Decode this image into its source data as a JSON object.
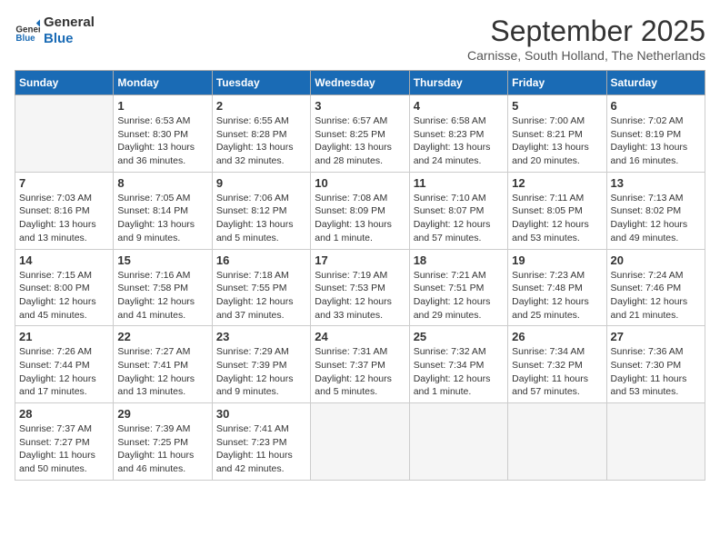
{
  "logo": {
    "text1": "General",
    "text2": "Blue"
  },
  "title": "September 2025",
  "location": "Carnisse, South Holland, The Netherlands",
  "weekdays": [
    "Sunday",
    "Monday",
    "Tuesday",
    "Wednesday",
    "Thursday",
    "Friday",
    "Saturday"
  ],
  "weeks": [
    [
      {
        "day": "",
        "info": ""
      },
      {
        "day": "1",
        "info": "Sunrise: 6:53 AM\nSunset: 8:30 PM\nDaylight: 13 hours\nand 36 minutes."
      },
      {
        "day": "2",
        "info": "Sunrise: 6:55 AM\nSunset: 8:28 PM\nDaylight: 13 hours\nand 32 minutes."
      },
      {
        "day": "3",
        "info": "Sunrise: 6:57 AM\nSunset: 8:25 PM\nDaylight: 13 hours\nand 28 minutes."
      },
      {
        "day": "4",
        "info": "Sunrise: 6:58 AM\nSunset: 8:23 PM\nDaylight: 13 hours\nand 24 minutes."
      },
      {
        "day": "5",
        "info": "Sunrise: 7:00 AM\nSunset: 8:21 PM\nDaylight: 13 hours\nand 20 minutes."
      },
      {
        "day": "6",
        "info": "Sunrise: 7:02 AM\nSunset: 8:19 PM\nDaylight: 13 hours\nand 16 minutes."
      }
    ],
    [
      {
        "day": "7",
        "info": "Sunrise: 7:03 AM\nSunset: 8:16 PM\nDaylight: 13 hours\nand 13 minutes."
      },
      {
        "day": "8",
        "info": "Sunrise: 7:05 AM\nSunset: 8:14 PM\nDaylight: 13 hours\nand 9 minutes."
      },
      {
        "day": "9",
        "info": "Sunrise: 7:06 AM\nSunset: 8:12 PM\nDaylight: 13 hours\nand 5 minutes."
      },
      {
        "day": "10",
        "info": "Sunrise: 7:08 AM\nSunset: 8:09 PM\nDaylight: 13 hours\nand 1 minute."
      },
      {
        "day": "11",
        "info": "Sunrise: 7:10 AM\nSunset: 8:07 PM\nDaylight: 12 hours\nand 57 minutes."
      },
      {
        "day": "12",
        "info": "Sunrise: 7:11 AM\nSunset: 8:05 PM\nDaylight: 12 hours\nand 53 minutes."
      },
      {
        "day": "13",
        "info": "Sunrise: 7:13 AM\nSunset: 8:02 PM\nDaylight: 12 hours\nand 49 minutes."
      }
    ],
    [
      {
        "day": "14",
        "info": "Sunrise: 7:15 AM\nSunset: 8:00 PM\nDaylight: 12 hours\nand 45 minutes."
      },
      {
        "day": "15",
        "info": "Sunrise: 7:16 AM\nSunset: 7:58 PM\nDaylight: 12 hours\nand 41 minutes."
      },
      {
        "day": "16",
        "info": "Sunrise: 7:18 AM\nSunset: 7:55 PM\nDaylight: 12 hours\nand 37 minutes."
      },
      {
        "day": "17",
        "info": "Sunrise: 7:19 AM\nSunset: 7:53 PM\nDaylight: 12 hours\nand 33 minutes."
      },
      {
        "day": "18",
        "info": "Sunrise: 7:21 AM\nSunset: 7:51 PM\nDaylight: 12 hours\nand 29 minutes."
      },
      {
        "day": "19",
        "info": "Sunrise: 7:23 AM\nSunset: 7:48 PM\nDaylight: 12 hours\nand 25 minutes."
      },
      {
        "day": "20",
        "info": "Sunrise: 7:24 AM\nSunset: 7:46 PM\nDaylight: 12 hours\nand 21 minutes."
      }
    ],
    [
      {
        "day": "21",
        "info": "Sunrise: 7:26 AM\nSunset: 7:44 PM\nDaylight: 12 hours\nand 17 minutes."
      },
      {
        "day": "22",
        "info": "Sunrise: 7:27 AM\nSunset: 7:41 PM\nDaylight: 12 hours\nand 13 minutes."
      },
      {
        "day": "23",
        "info": "Sunrise: 7:29 AM\nSunset: 7:39 PM\nDaylight: 12 hours\nand 9 minutes."
      },
      {
        "day": "24",
        "info": "Sunrise: 7:31 AM\nSunset: 7:37 PM\nDaylight: 12 hours\nand 5 minutes."
      },
      {
        "day": "25",
        "info": "Sunrise: 7:32 AM\nSunset: 7:34 PM\nDaylight: 12 hours\nand 1 minute."
      },
      {
        "day": "26",
        "info": "Sunrise: 7:34 AM\nSunset: 7:32 PM\nDaylight: 11 hours\nand 57 minutes."
      },
      {
        "day": "27",
        "info": "Sunrise: 7:36 AM\nSunset: 7:30 PM\nDaylight: 11 hours\nand 53 minutes."
      }
    ],
    [
      {
        "day": "28",
        "info": "Sunrise: 7:37 AM\nSunset: 7:27 PM\nDaylight: 11 hours\nand 50 minutes."
      },
      {
        "day": "29",
        "info": "Sunrise: 7:39 AM\nSunset: 7:25 PM\nDaylight: 11 hours\nand 46 minutes."
      },
      {
        "day": "30",
        "info": "Sunrise: 7:41 AM\nSunset: 7:23 PM\nDaylight: 11 hours\nand 42 minutes."
      },
      {
        "day": "",
        "info": ""
      },
      {
        "day": "",
        "info": ""
      },
      {
        "day": "",
        "info": ""
      },
      {
        "day": "",
        "info": ""
      }
    ]
  ]
}
